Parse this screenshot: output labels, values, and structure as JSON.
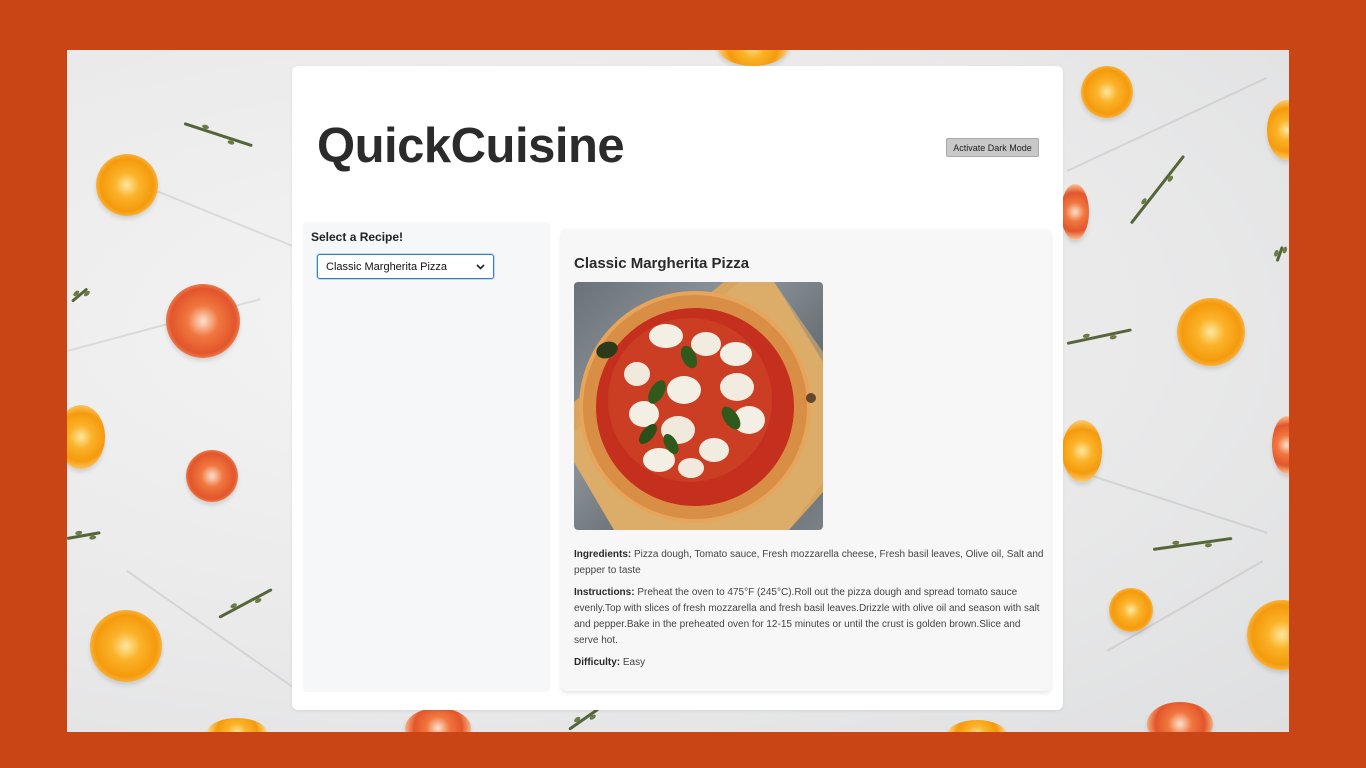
{
  "app": {
    "title": "QuickCuisine",
    "dark_mode_button": "Activate Dark Mode"
  },
  "sidebar": {
    "heading": "Select a Recipe!",
    "selected_recipe": "Classic Margherita Pizza",
    "select_icon": "chevron-down-icon"
  },
  "recipe": {
    "title": "Classic Margherita Pizza",
    "image_subject": "pizza-image",
    "ingredients_label": "Ingredients:",
    "ingredients": "Pizza dough, Tomato sauce, Fresh mozzarella cheese, Fresh basil leaves, Olive oil, Salt and pepper to taste",
    "instructions_label": "Instructions:",
    "instructions": "Preheat the oven to 475°F (245°C).Roll out the pizza dough and spread tomato sauce evenly.Top with slices of fresh mozzarella and fresh basil leaves.Drizzle with olive oil and season with salt and pepper.Bake in the preheated oven for 12-15 minutes or until the crust is golden brown.Slice and serve hot.",
    "difficulty_label": "Difficulty:",
    "difficulty": "Easy"
  },
  "colors": {
    "frame": "#c94515",
    "title_text": "#2b2b2b",
    "select_focus": "#2f7fd1"
  }
}
